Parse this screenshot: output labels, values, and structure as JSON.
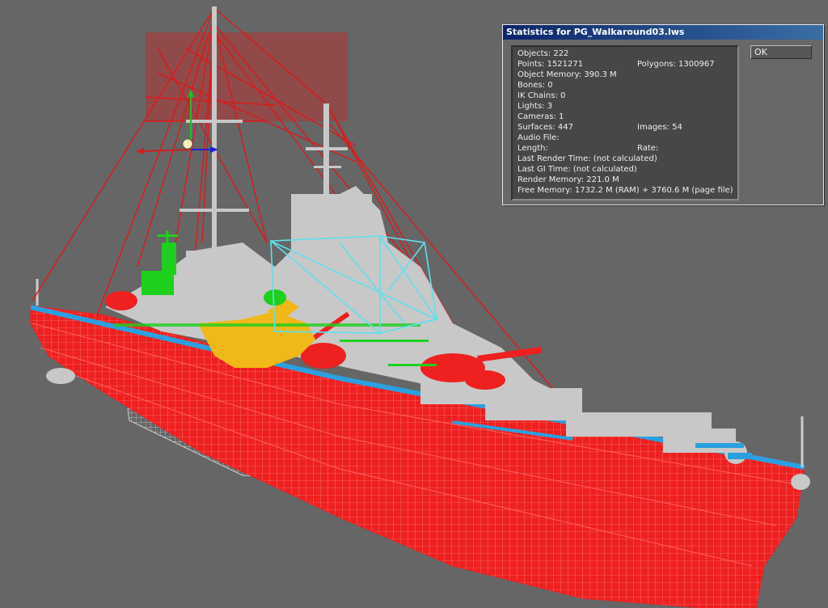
{
  "dialog": {
    "title": "Statistics for PG_Walkaround03.lws",
    "ok_label": "OK",
    "stats": {
      "objects": "Objects: 222",
      "points": "Points: 1521271",
      "polygons": "Polygons: 1300967",
      "object_memory": "Object Memory: 390.3 M",
      "bones": "Bones: 0",
      "ik_chains": "IK Chains: 0",
      "lights": "Lights: 3",
      "cameras": "Cameras: 1",
      "surfaces": "Surfaces: 447",
      "images": "Images: 54",
      "audio_file": "Audio File:",
      "length": "Length:",
      "rate": "Rate:",
      "last_render_time": "Last Render Time: (not calculated)",
      "last_gi_time": "Last GI Time: (not calculated)",
      "render_memory": "Render Memory: 221.0 M",
      "free_memory": "Free Memory: 1732.2 M (RAM) + 3760.6 M (page file)"
    }
  },
  "viewport": {
    "background": "#666666",
    "colors": {
      "hull": "#ee2020",
      "rigging": "#e01818",
      "superstructure": "#c8c8c8",
      "deck_rail": "#2aa0e0",
      "cyan_frame": "#5ee0f0",
      "green_parts": "#1ed01e",
      "yellow_parts": "#f0b818"
    },
    "gizmo_icon": "move-gizmo-icon"
  }
}
